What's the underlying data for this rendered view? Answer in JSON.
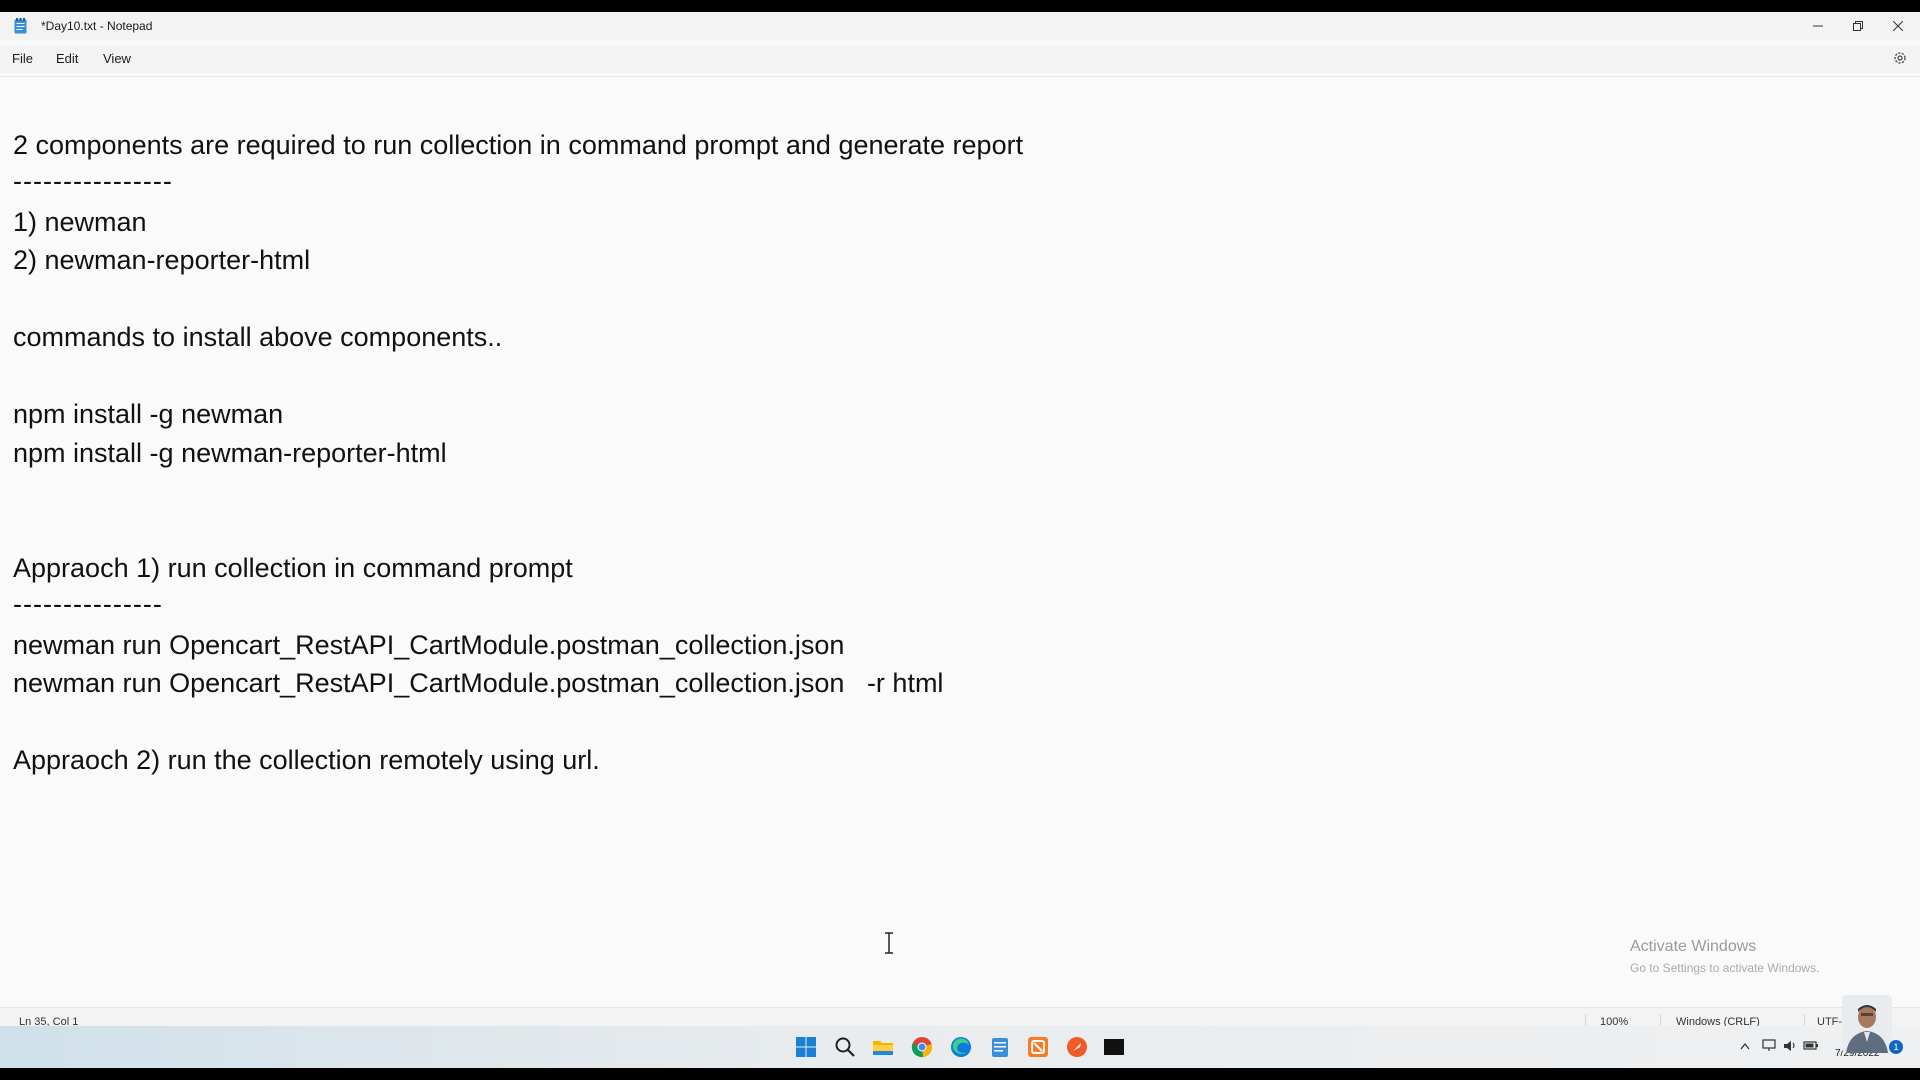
{
  "window": {
    "title": "*Day10.txt - Notepad"
  },
  "menu": {
    "file": "File",
    "edit": "Edit",
    "view": "View"
  },
  "editor": {
    "lines": [
      "2 components are required to run collection in command prompt and generate report",
      "----------------",
      "1) newman",
      "2) newman-reporter-html",
      "commands to install above components..",
      "npm install -g newman",
      "npm install -g newman-reporter-html",
      "Appraoch 1) run collection in command prompt",
      "---------------",
      "newman run Opencart_RestAPI_CartModule.postman_collection.json",
      "newman run Opencart_RestAPI_CartModule.postman_collection.json   -r html",
      "Appraoch 2) run the collection remotely using url."
    ]
  },
  "watermark": {
    "title": "Activate Windows",
    "subtitle": "Go to Settings to activate Windows."
  },
  "status": {
    "position": "Ln 35, Col 1",
    "zoom": "100%",
    "line_ending": "Windows (CRLF)",
    "encoding": "UTF-8"
  },
  "taskbar": {
    "date": "7/29/2022",
    "notification_count": "1",
    "icons": [
      "start-icon",
      "search-icon",
      "file-explorer-icon",
      "chrome-icon",
      "edge-icon",
      "notepad-icon",
      "xampp-icon",
      "postman-icon",
      "terminal-icon"
    ]
  },
  "colors": {
    "accent": "#0067c0",
    "editor_bg": "#fafafa",
    "chrome_bg": "#f3f3f3"
  }
}
